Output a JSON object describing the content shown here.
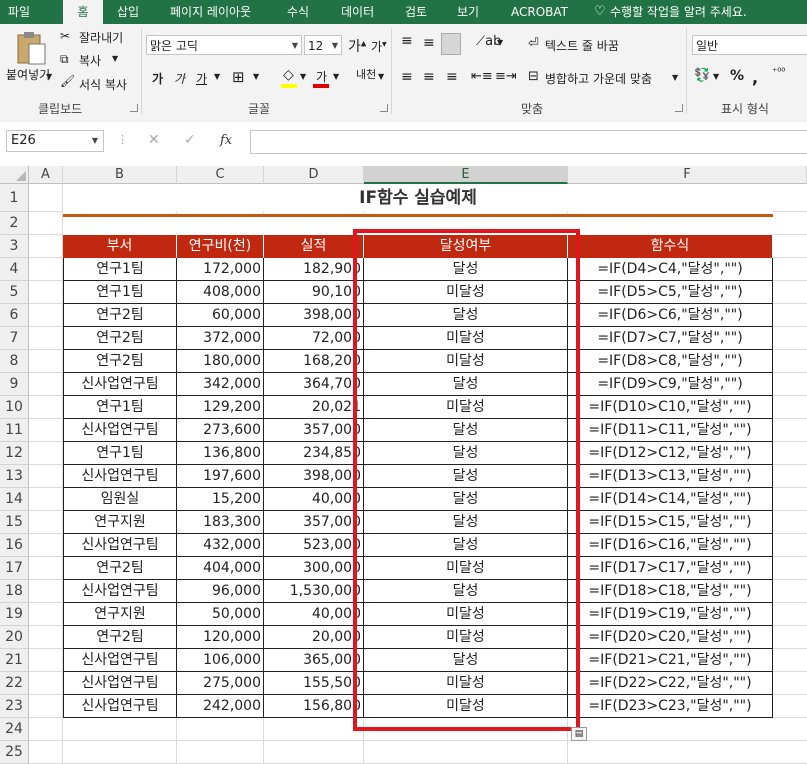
{
  "tabs": [
    "파일",
    "홈",
    "삽입",
    "페이지 레이아웃",
    "수식",
    "데이터",
    "검토",
    "보기",
    "ACROBAT"
  ],
  "active_tab": "홈",
  "tell_me": "수행할 작업을 알려 주세요.",
  "ribbon": {
    "clipboard": {
      "paste": "붙여넣기",
      "cut": "잘라내기",
      "copy": "복사",
      "format_painter": "서식 복사",
      "label": "클립보드"
    },
    "font": {
      "name": "맑은 고딕",
      "size": "12",
      "label": "글꼴"
    },
    "alignment": {
      "wrap": "텍스트 줄 바꿈",
      "merge": "병합하고 가운데 맞춤",
      "label": "맞춤"
    },
    "number": {
      "format": "일반",
      "label": "표시 형식"
    }
  },
  "name_box": "E26",
  "fx": "fx",
  "columns": [
    "A",
    "B",
    "C",
    "D",
    "E",
    "F"
  ],
  "rows": [
    "1",
    "2",
    "3",
    "4",
    "5",
    "6",
    "7",
    "8",
    "9",
    "10",
    "11",
    "12",
    "13",
    "14",
    "15",
    "16",
    "17",
    "18",
    "19",
    "20",
    "21",
    "22",
    "23",
    "24",
    "25"
  ],
  "title": "IF함수 실습예제",
  "headers": [
    "부서",
    "연구비(천)",
    "실적",
    "달성여부",
    "함수식"
  ],
  "table": [
    [
      "연구1팀",
      "172,000",
      "182,900",
      "달성",
      "=IF(D4>C4,\"달성\",\"\")"
    ],
    [
      "연구1팀",
      "408,000",
      "90,100",
      "미달성",
      "=IF(D5>C5,\"달성\",\"\")"
    ],
    [
      "연구2팀",
      "60,000",
      "398,000",
      "달성",
      "=IF(D6>C6,\"달성\",\"\")"
    ],
    [
      "연구2팀",
      "372,000",
      "72,000",
      "미달성",
      "=IF(D7>C7,\"달성\",\"\")"
    ],
    [
      "연구2팀",
      "180,000",
      "168,200",
      "미달성",
      "=IF(D8>C8,\"달성\",\"\")"
    ],
    [
      "신사업연구팀",
      "342,000",
      "364,700",
      "달성",
      "=IF(D9>C9,\"달성\",\"\")"
    ],
    [
      "연구1팀",
      "129,200",
      "20,021",
      "미달성",
      "=IF(D10>C10,\"달성\",\"\")"
    ],
    [
      "신사업연구팀",
      "273,600",
      "357,000",
      "달성",
      "=IF(D11>C11,\"달성\",\"\")"
    ],
    [
      "연구1팀",
      "136,800",
      "234,850",
      "달성",
      "=IF(D12>C12,\"달성\",\"\")"
    ],
    [
      "신사업연구팀",
      "197,600",
      "398,000",
      "달성",
      "=IF(D13>C13,\"달성\",\"\")"
    ],
    [
      "임원실",
      "15,200",
      "40,000",
      "달성",
      "=IF(D14>C14,\"달성\",\"\")"
    ],
    [
      "연구지원",
      "183,300",
      "357,000",
      "달성",
      "=IF(D15>C15,\"달성\",\"\")"
    ],
    [
      "신사업연구팀",
      "432,000",
      "523,000",
      "달성",
      "=IF(D16>C16,\"달성\",\"\")"
    ],
    [
      "연구2팀",
      "404,000",
      "300,000",
      "미달성",
      "=IF(D17>C17,\"달성\",\"\")"
    ],
    [
      "신사업연구팀",
      "96,000",
      "1,530,000",
      "달성",
      "=IF(D18>C18,\"달성\",\"\")"
    ],
    [
      "연구지원",
      "50,000",
      "40,000",
      "미달성",
      "=IF(D19>C19,\"달성\",\"\")"
    ],
    [
      "연구2팀",
      "120,000",
      "20,000",
      "미달성",
      "=IF(D20>C20,\"달성\",\"\")"
    ],
    [
      "신사업연구팀",
      "106,000",
      "365,000",
      "달성",
      "=IF(D21>C21,\"달성\",\"\")"
    ],
    [
      "신사업연구팀",
      "275,000",
      "155,500",
      "미달성",
      "=IF(D22>C22,\"달성\",\"\")"
    ],
    [
      "신사업연구팀",
      "242,000",
      "156,800",
      "미달성",
      "=IF(D23>C23,\"달성\",\"\")"
    ]
  ],
  "colors": {
    "brand": "#217346",
    "header_fill": "#c0280f",
    "highlight": "#e0161e",
    "title_underline": "#c55a11"
  }
}
